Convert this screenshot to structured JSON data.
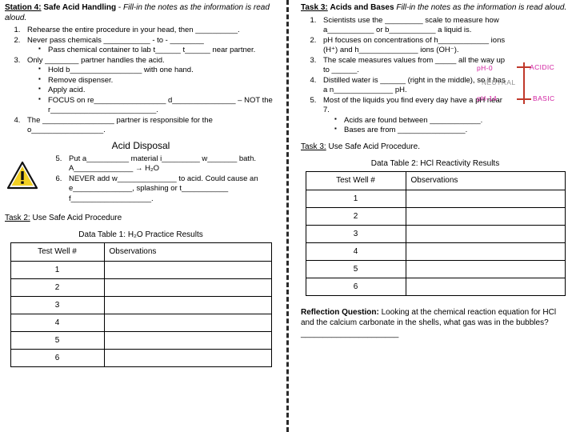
{
  "left": {
    "station_label": "Station 4:",
    "station_title": "Safe Acid Handling",
    "station_dash": "-",
    "station_instruction": "Fill-in the notes as the information is read aloud.",
    "items": [
      "Rehearse the entire procedure in your head, then __________.",
      "Never pass chemicals ___________ - to - ________",
      "Only ________ partner handles the acid.",
      "The _________________ partner is responsible for the o_________________."
    ],
    "item2_sub": [
      "Pass chemical container to lab t______ t______ near partner."
    ],
    "item3_sub": [
      "Hold b_________________ with one hand.",
      "Remove dispenser.",
      "Apply acid.",
      "FOCUS on re_________________ d_______________ – NOT the r_________________________."
    ],
    "acid_disposal_title": "Acid Disposal",
    "disposal_items": [
      "Put a__________ material i_________ w_______ bath.    A______________ → H₂O",
      "NEVER add w______________ to acid.  Could cause an e______________, splashing or t___________ f___________________."
    ],
    "task2_label": "Task 2:",
    "task2_text": "Use Safe Acid Procedure",
    "table_title_prefix": "Data Table 1:",
    "table_title_main": "H₂O Practice Results",
    "table_headers": [
      "Test Well #",
      "Observations"
    ],
    "table_rows": [
      "1",
      "2",
      "3",
      "4",
      "5",
      "6"
    ]
  },
  "right": {
    "task_label": "Task 3:",
    "task_title": "Acids and Bases",
    "task_instruction": "Fill-in the notes as the information is read aloud.",
    "items": [
      "Scientists use the _________ scale to measure how a___________ or b___________ a liquid is.",
      "pH focuses on concentrations of h____________ ions (H⁺) and h______________ ions (OH⁻).",
      "The scale measures values from _____ all the way up to ______.",
      "Distilled water is ______ (right in the middle), so it has a n______________ pH.",
      "Most of the liquids you find every day have a pH near 7."
    ],
    "item5_sub": [
      "Acids are found between ____________.",
      "Bases are from ________________."
    ],
    "ph_scale": {
      "top_left": "pH-0",
      "bottom_left": "pH-14",
      "top_right": "ACIDIC",
      "bottom_right": "BASIC",
      "middle": "NEUTRAL",
      "color_labels": "#d11fa0",
      "color_cross": "#c0392b",
      "color_neutral": "#8f8f8f"
    },
    "task3_label": "Task 3:",
    "task3_text": "Use Safe Acid Procedure.",
    "table_title_prefix": "Data Table 2:",
    "table_title_main": "HCl Reactivity Results",
    "table_headers": [
      "Test Well #",
      "Observations"
    ],
    "table_rows": [
      "1",
      "2",
      "3",
      "4",
      "5",
      "6"
    ],
    "reflection_label": "Reflection Question:",
    "reflection_text": "Looking at the chemical reaction equation for HCl and the calcium carbonate in the shells, what gas was in the bubbles?  ______________________"
  }
}
